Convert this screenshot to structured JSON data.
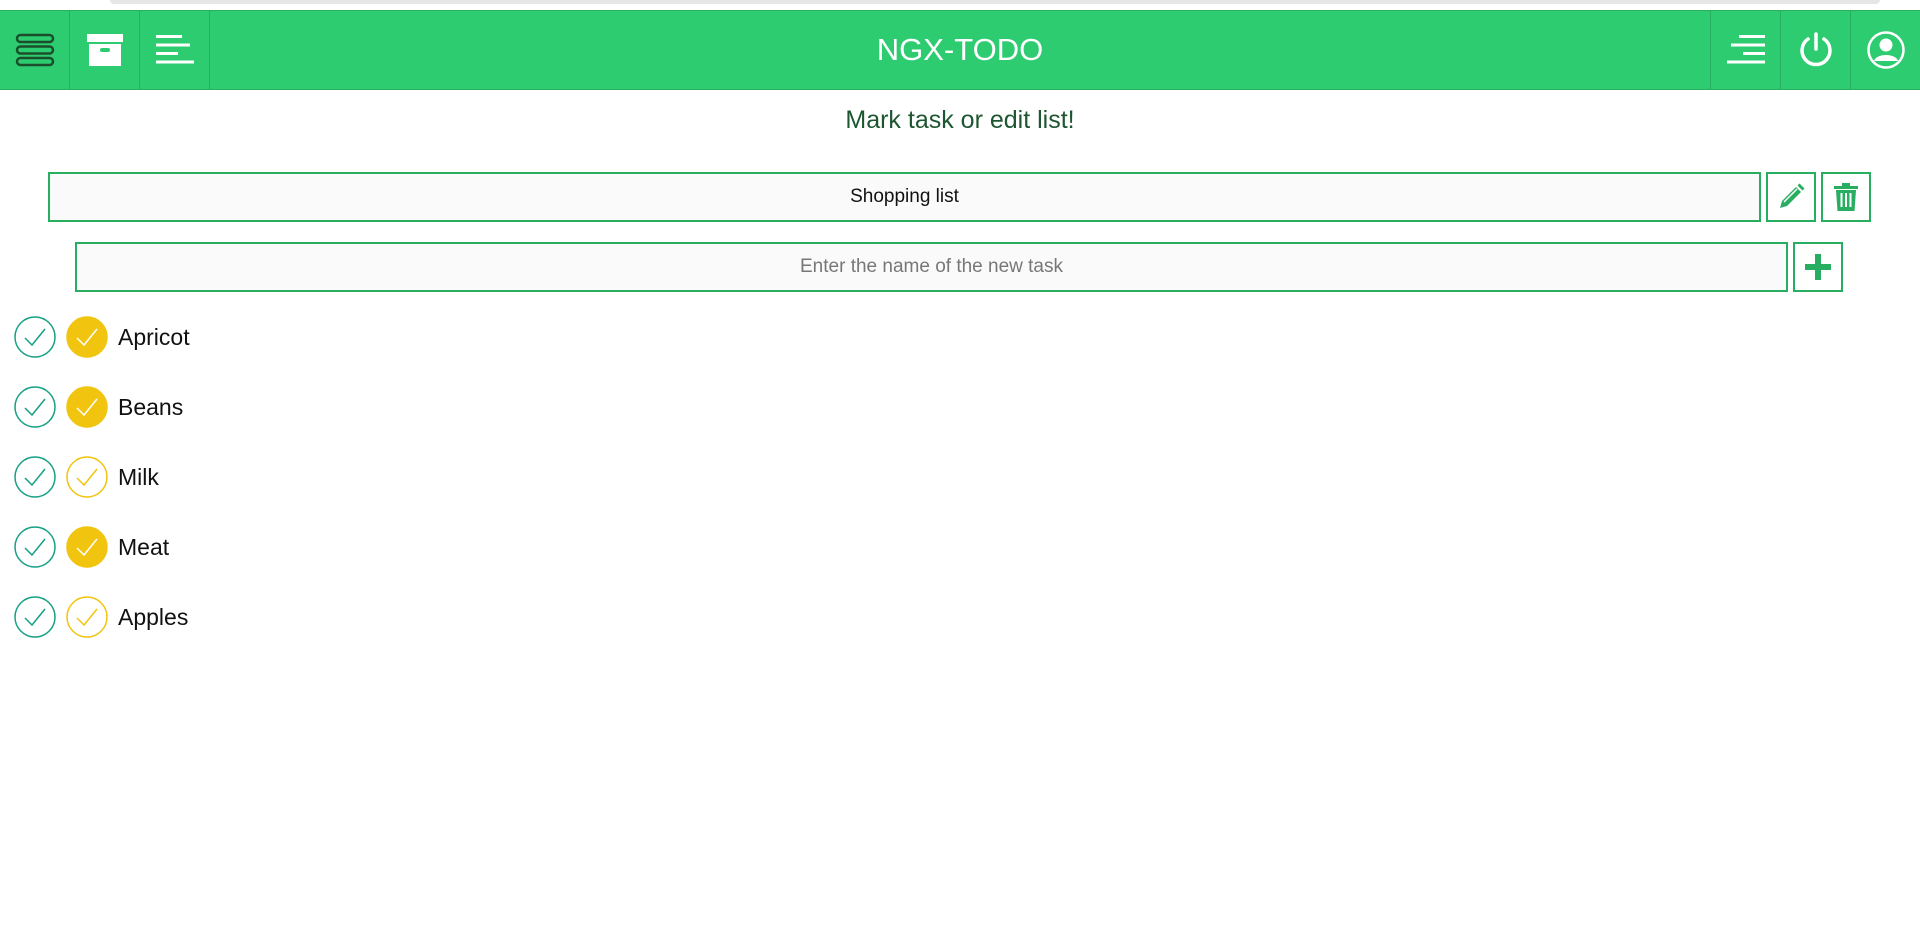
{
  "app": {
    "title": "NGX-TODO"
  },
  "navbar": {
    "left_icons": [
      "menu-icon",
      "archive-icon",
      "lists-icon"
    ],
    "right_icons": [
      "align-right-icon",
      "power-icon",
      "user-icon"
    ]
  },
  "main": {
    "heading": "Mark task or edit list!",
    "list_name": "Shopping list",
    "new_task_placeholder": "Enter the name of the new task",
    "list_actions": [
      "pencil-icon",
      "trash-icon"
    ],
    "add_action": "plus-icon"
  },
  "tasks": [
    {
      "name": "Apricot",
      "marked": true
    },
    {
      "name": "Beans",
      "marked": true
    },
    {
      "name": "Milk",
      "marked": false
    },
    {
      "name": "Meat",
      "marked": true
    },
    {
      "name": "Apples",
      "marked": false
    }
  ],
  "colors": {
    "primary": "#2ecc71",
    "primary_dark": "#27ae60",
    "heading": "#1e5631",
    "done_check": "#16a085",
    "mark_check": "#f1c40f"
  }
}
